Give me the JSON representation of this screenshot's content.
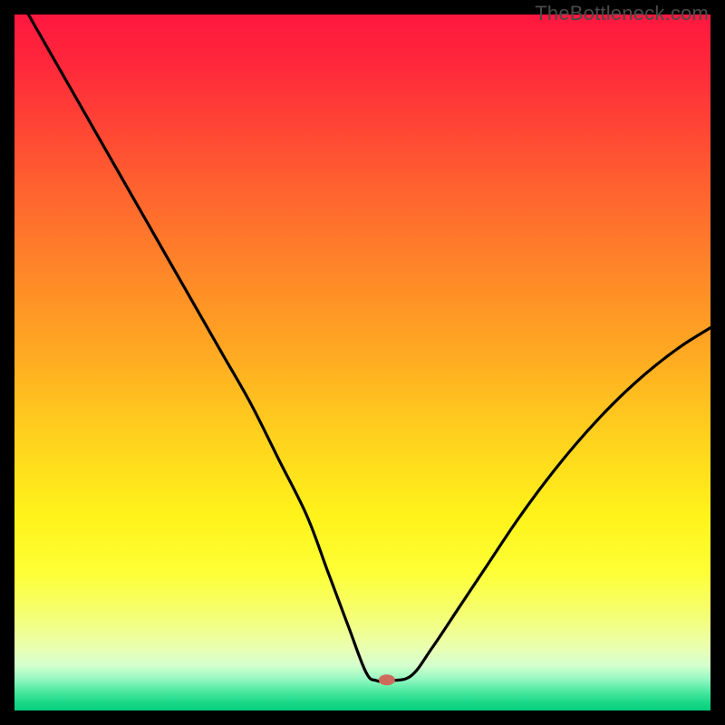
{
  "watermark": "TheBottleneck.com",
  "chart_data": {
    "type": "line",
    "title": "",
    "xlabel": "",
    "ylabel": "",
    "xlim": [
      0,
      100
    ],
    "ylim": [
      0,
      100
    ],
    "grid": false,
    "legend": false,
    "series": [
      {
        "name": "curve",
        "x": [
          2,
          6,
          10,
          14,
          18,
          22,
          26,
          30,
          34,
          38,
          42,
          45,
          48,
          50.5,
          52,
          54,
          57,
          60,
          64,
          68,
          72,
          76,
          80,
          84,
          88,
          92,
          96,
          100
        ],
        "y": [
          100,
          93,
          86,
          79,
          72,
          65,
          58,
          51,
          44,
          36,
          28,
          20,
          12,
          5.5,
          4.3,
          4.3,
          5,
          9,
          15,
          21,
          27,
          32.5,
          37.5,
          42,
          46,
          49.5,
          52.5,
          55
        ]
      }
    ],
    "marker": {
      "x": 53.5,
      "y": 4.4,
      "color": "#cd6a5b",
      "rx": 9,
      "ry": 6
    },
    "gradient_stops": [
      {
        "offset": 0.0,
        "color": "#ff173f"
      },
      {
        "offset": 0.08,
        "color": "#ff2a3b"
      },
      {
        "offset": 0.2,
        "color": "#ff5232"
      },
      {
        "offset": 0.34,
        "color": "#ff7e2a"
      },
      {
        "offset": 0.48,
        "color": "#ffa722"
      },
      {
        "offset": 0.6,
        "color": "#ffcf1e"
      },
      {
        "offset": 0.72,
        "color": "#fff31a"
      },
      {
        "offset": 0.8,
        "color": "#feff35"
      },
      {
        "offset": 0.86,
        "color": "#f5ff70"
      },
      {
        "offset": 0.905,
        "color": "#ecffab"
      },
      {
        "offset": 0.935,
        "color": "#d6ffce"
      },
      {
        "offset": 0.955,
        "color": "#94f8c1"
      },
      {
        "offset": 0.972,
        "color": "#4fe9a2"
      },
      {
        "offset": 0.988,
        "color": "#1cd989"
      },
      {
        "offset": 1.0,
        "color": "#06cf7c"
      }
    ]
  }
}
